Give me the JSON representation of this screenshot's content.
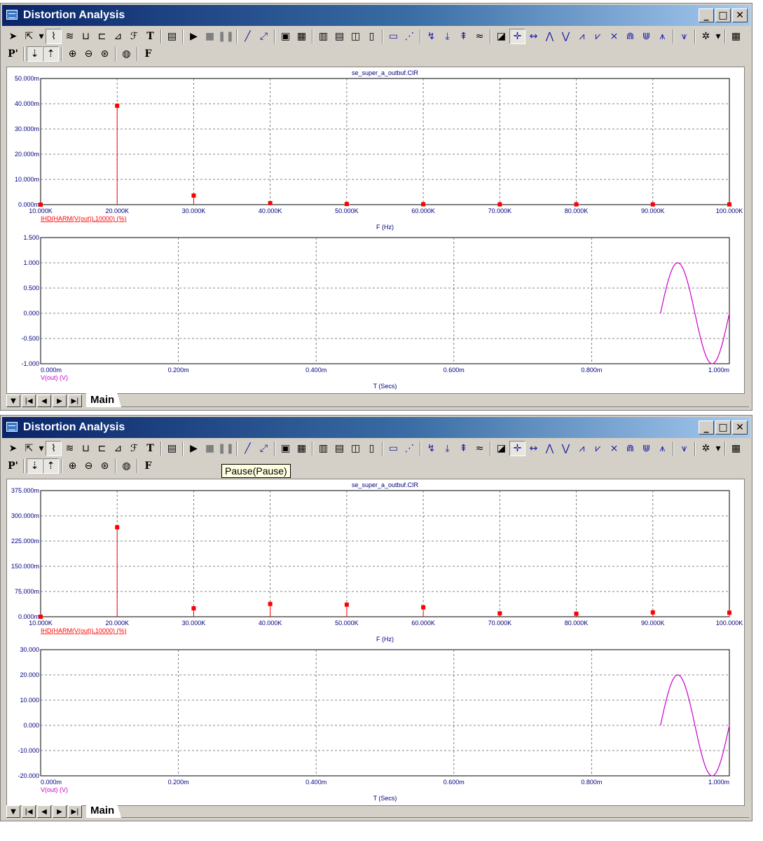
{
  "windows": [
    {
      "title": "Distortion Analysis",
      "tab_label": "Main",
      "plot_title": "se_super_a_outbuf.CIR",
      "top_plot": {
        "xlabel": "F (Hz)",
        "trace_label": "IHD(HARM(V(out)),10000) (%)",
        "y_ticks": [
          "0.000m",
          "10.000m",
          "20.000m",
          "30.000m",
          "40.000m",
          "50.000m"
        ],
        "x_ticks": [
          "10.000K",
          "20.000K",
          "30.000K",
          "40.000K",
          "50.000K",
          "60.000K",
          "70.000K",
          "80.000K",
          "90.000K",
          "100.000K"
        ]
      },
      "bottom_plot": {
        "xlabel": "T (Secs)",
        "trace_label": "V(out) (V)",
        "y_ticks": [
          "-1.000",
          "-0.500",
          "0.000",
          "0.500",
          "1.000",
          "1.500"
        ],
        "x_ticks": [
          "0.000m",
          "0.200m",
          "0.400m",
          "0.600m",
          "0.800m",
          "1.000m"
        ]
      }
    },
    {
      "title": "Distortion Analysis",
      "tab_label": "Main",
      "plot_title": "se_super_a_outbuf.CIR",
      "top_plot": {
        "xlabel": "F (Hz)",
        "trace_label": "IHD(HARM(V(out)),10000) (%)",
        "y_ticks": [
          "0.000m",
          "75.000m",
          "150.000m",
          "225.000m",
          "300.000m",
          "375.000m"
        ],
        "x_ticks": [
          "10.000K",
          "20.000K",
          "30.000K",
          "40.000K",
          "50.000K",
          "60.000K",
          "70.000K",
          "80.000K",
          "90.000K",
          "100.000K"
        ]
      },
      "bottom_plot": {
        "xlabel": "T (Secs)",
        "trace_label": "V(out) (V)",
        "y_ticks": [
          "-20.000",
          "-10.000",
          "0.000",
          "10.000",
          "20.000",
          "30.000"
        ],
        "x_ticks": [
          "0.000m",
          "0.200m",
          "0.400m",
          "0.600m",
          "0.800m",
          "1.000m"
        ]
      }
    }
  ],
  "tooltip": "Pause(Pause)",
  "colors": {
    "harmonic_trace": "#ff0000",
    "time_trace": "#cc00cc",
    "axis_text": "#000080",
    "title_text": "#000080"
  },
  "toolbar1_icons": [
    "select-arrow-icon",
    "scale-icon",
    "dropdown-icon",
    "plot-mode-icon",
    "waveform-icon",
    "tag-icon",
    "component-icon",
    "point-tag-icon",
    "fourier-icon",
    "text-tool-icon",
    "properties-icon",
    "run-icon",
    "stop-icon",
    "pause-icon",
    "line-icon",
    "diagonal-line-icon",
    "box-icon",
    "grid-icon",
    "vgrid-icon",
    "hgrid-icon",
    "split-icon",
    "split2-icon",
    "rectangle-icon",
    "slope-icon",
    "cursor-left-icon",
    "cursor-right-icon",
    "cursor-peak-icon",
    "wave-icon",
    "chart-icon",
    "cursor-mode-icon",
    "cursor-next-icon",
    "peak-icon",
    "valley-icon",
    "high-icon",
    "low-icon",
    "inflection-icon",
    "global-high-icon",
    "global-low-icon",
    "top-icon",
    "bottom-icon",
    "settings-icon",
    "dropdown2-icon",
    "table-icon"
  ],
  "toolbar2_icons": [
    "p-icon",
    "cursor-a-icon",
    "cursor-b-icon",
    "zoom-in-icon",
    "zoom-out-icon",
    "zoom-fit-icon",
    "palette-icon",
    "font-f-icon"
  ],
  "nav_buttons": [
    "nav-menu-icon",
    "nav-first-icon",
    "nav-prev-icon",
    "nav-next-icon",
    "nav-last-icon"
  ],
  "chart_data": [
    {
      "type": "bar",
      "title": "se_super_a_outbuf.CIR",
      "xlabel": "F (Hz)",
      "ylabel": "",
      "series": [
        {
          "name": "IHD(HARM(V(out)),10000) (%)",
          "x_khz": [
            10,
            20,
            30,
            40,
            50,
            60,
            70,
            80,
            90,
            100
          ],
          "values_m": [
            0,
            39.2,
            3.6,
            0.6,
            0.25,
            0.15,
            0.1,
            0.1,
            0.1,
            0.1
          ]
        }
      ],
      "xlim_khz": [
        10,
        100
      ],
      "ylim_m": [
        0,
        50
      ],
      "grid": true
    },
    {
      "type": "line",
      "xlabel": "T (Secs)",
      "series": [
        {
          "name": "V(out) (V)",
          "t_start_m": 0.9,
          "t_end_m": 1.0,
          "amplitude": 1.0,
          "cycles": 1
        }
      ],
      "xlim_m": [
        0,
        1
      ],
      "ylim": [
        -1,
        1.5
      ],
      "grid": true
    },
    {
      "type": "bar",
      "title": "se_super_a_outbuf.CIR",
      "xlabel": "F (Hz)",
      "ylabel": "",
      "series": [
        {
          "name": "IHD(HARM(V(out)),10000) (%)",
          "x_khz": [
            10,
            20,
            30,
            40,
            50,
            60,
            70,
            80,
            90,
            100
          ],
          "values_m": [
            0,
            266,
            25,
            38,
            36,
            28,
            10,
            9,
            13,
            12
          ]
        }
      ],
      "xlim_khz": [
        10,
        100
      ],
      "ylim_m": [
        0,
        375
      ],
      "grid": true
    },
    {
      "type": "line",
      "xlabel": "T (Secs)",
      "series": [
        {
          "name": "V(out) (V)",
          "t_start_m": 0.9,
          "t_end_m": 1.0,
          "amplitude": 20.0,
          "cycles": 1
        }
      ],
      "xlim_m": [
        0,
        1
      ],
      "ylim": [
        -20,
        30
      ],
      "grid": true
    }
  ]
}
